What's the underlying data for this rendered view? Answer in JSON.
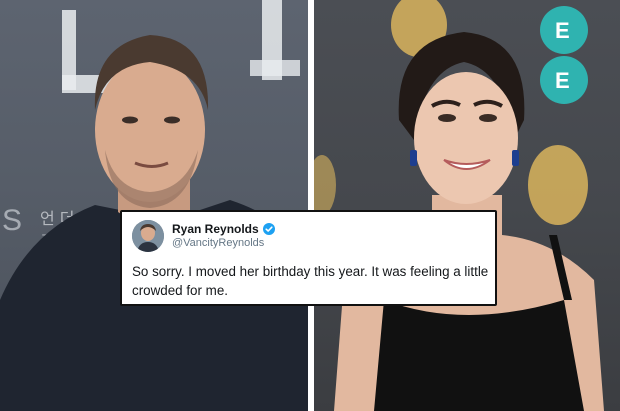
{
  "tweet": {
    "name": "Ryan Reynolds",
    "handle": "@VancityReynolds",
    "text": "So sorry. I moved her birthday this year. It was feeling a little crowded for me.",
    "verified_icon": "verified-badge-icon"
  },
  "colors": {
    "verified": "#1da1f2",
    "tweet_border": "#111111",
    "handle": "#657786"
  },
  "photos": {
    "left_icon": "man-portrait-photo",
    "right_icon": "woman-portrait-photo"
  }
}
